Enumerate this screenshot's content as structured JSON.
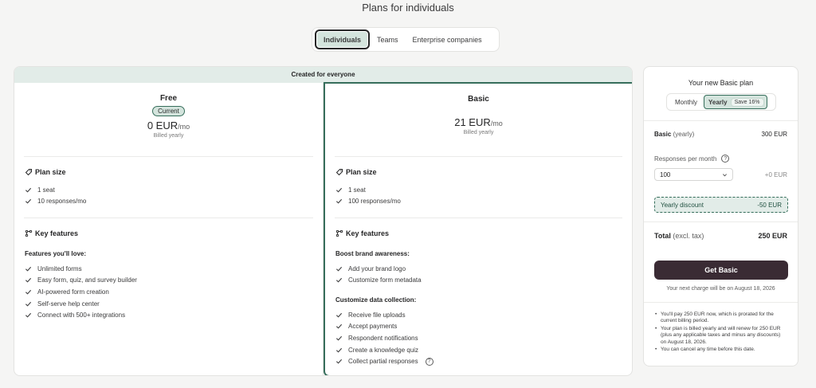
{
  "page": {
    "title": "Plans for individuals"
  },
  "segments": [
    {
      "label": "Individuals"
    },
    {
      "label": "Teams"
    },
    {
      "label": "Enterprise companies"
    }
  ],
  "banner": "Created for everyone",
  "plans": {
    "free": {
      "name": "Free",
      "badge": "Current",
      "price": "0 EUR",
      "per": "/mo",
      "billed": "Billed yearly",
      "plan_size_title": "Plan size",
      "size_items": [
        "1 seat",
        "10 responses/mo"
      ],
      "key_features_title": "Key features",
      "features_subhead": "Features you'll love:",
      "features": [
        "Unlimited forms",
        "Easy form, quiz, and survey builder",
        "AI-powered form creation",
        "Self-serve help center",
        "Connect with 500+ integrations"
      ]
    },
    "basic": {
      "name": "Basic",
      "price": "21 EUR",
      "per": "/mo",
      "billed": "Billed yearly",
      "plan_size_title": "Plan size",
      "size_items": [
        "1 seat",
        "100 responses/mo"
      ],
      "key_features_title": "Key features",
      "brand_subhead": "Boost brand awareness:",
      "brand_features": [
        "Add your brand logo",
        "Customize form metadata"
      ],
      "data_subhead": "Customize data collection:",
      "data_features": [
        "Receive file uploads",
        "Accept payments",
        "Respondent notifications",
        "Create a knowledge quiz",
        "Collect partial responses"
      ]
    }
  },
  "summary": {
    "title": "Your new Basic plan",
    "toggle_monthly": "Monthly",
    "toggle_yearly": "Yearly",
    "save_badge": "Save 16%",
    "line_label": "Basic",
    "line_period": "(yearly)",
    "line_value": "300 EUR",
    "responses_label": "Responses per month",
    "responses_value": "100",
    "responses_price": "+0 EUR",
    "discount_label": "Yearly discount",
    "discount_value": "-50 EUR",
    "total_label": "Total",
    "total_note": "(excl. tax)",
    "total_value": "250 EUR",
    "cta": "Get Basic",
    "next_charge": "Your next charge will be on August 18, 2026",
    "notes": [
      "You'll pay 250 EUR now, which is prorated for the current billing period.",
      "Your plan is billed yearly and will renew for 250 EUR (plus any applicable taxes and minus any discounts) on August 18, 2026.",
      "You can cancel any time before this date."
    ]
  }
}
